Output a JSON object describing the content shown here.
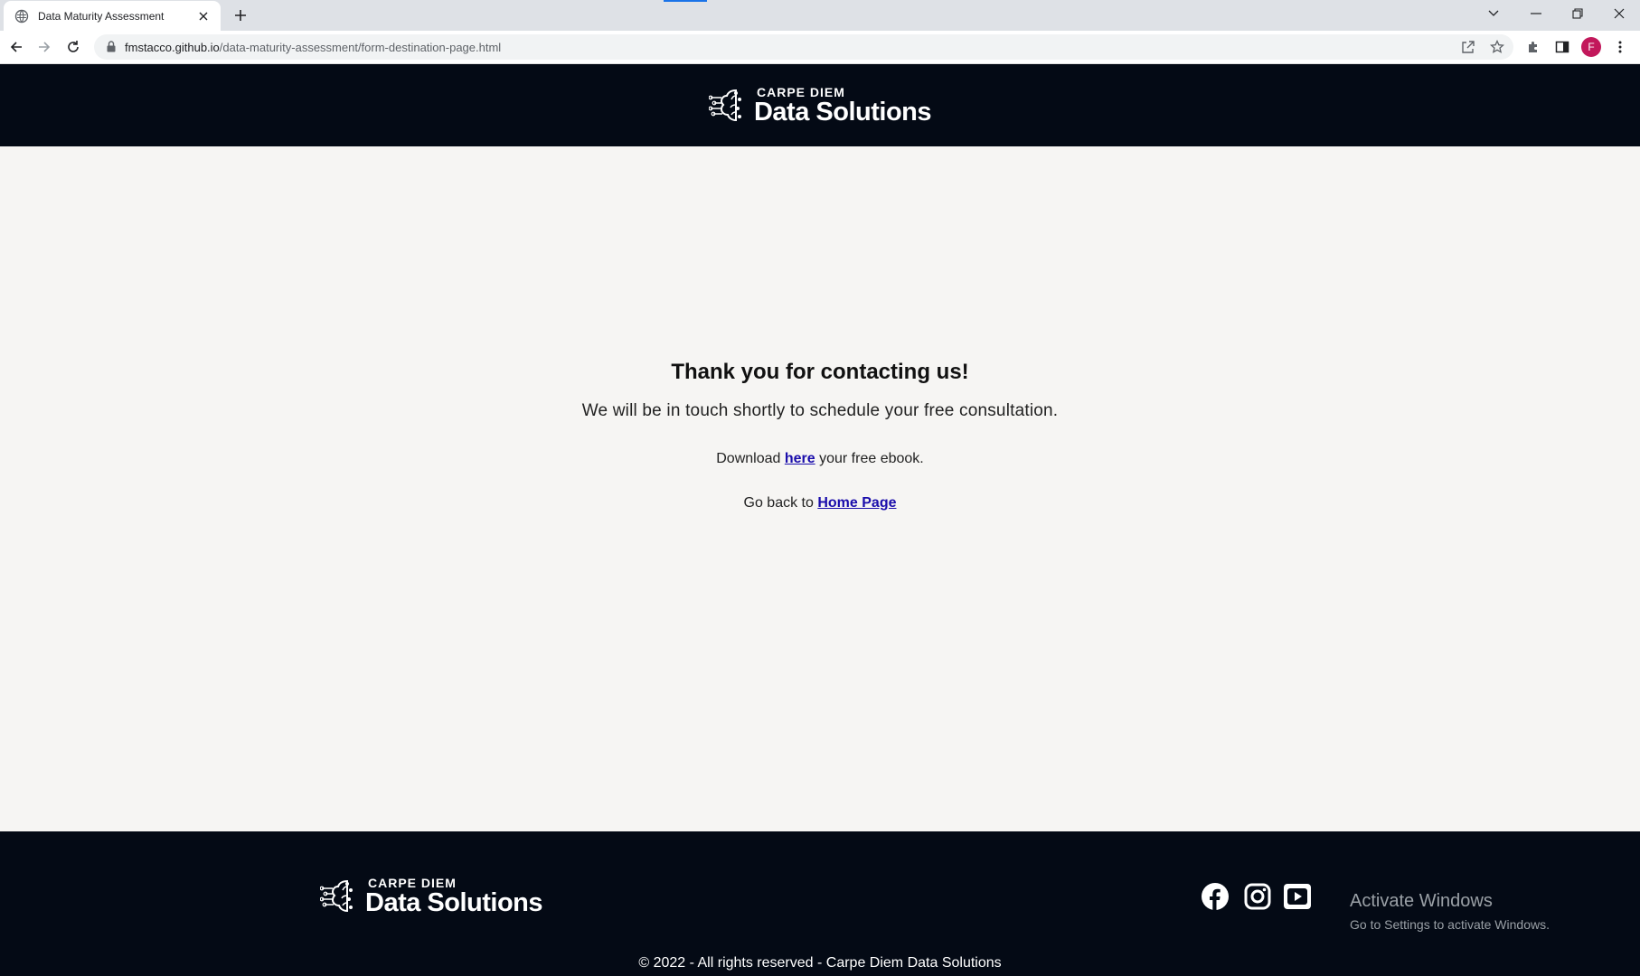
{
  "browser": {
    "tab_title": "Data Maturity Assessment",
    "url_host": "fmstacco.github.io",
    "url_path": "/data-maturity-assessment/form-destination-page.html",
    "profile_initial": "F",
    "profile_color": "#c2185b",
    "icons": [
      "globe-icon",
      "close-icon",
      "plus-icon",
      "chevron-down-icon",
      "minimize-icon",
      "restore-icon",
      "window-close-icon",
      "back-icon",
      "forward-icon",
      "reload-icon",
      "lock-icon",
      "share-icon",
      "star-icon",
      "extensions-icon",
      "side-panel-icon",
      "kebab-menu-icon"
    ]
  },
  "header": {
    "logo_top": "CARPE DIEM",
    "logo_bottom": "Data Solutions"
  },
  "main": {
    "heading": "Thank you for contacting us!",
    "subtext": "We will be in touch shortly to schedule your free consultation.",
    "download_prefix": "Download",
    "download_link": "here",
    "download_suffix": "your free ebook.",
    "back_prefix": "Go back to",
    "back_link": "Home Page"
  },
  "footer": {
    "logo_top": "CARPE DIEM",
    "logo_bottom": "Data Solutions",
    "social": [
      "facebook-icon",
      "instagram-icon",
      "youtube-icon"
    ],
    "copyright": "© 2022 - All rights reserved - Carpe Diem Data Solutions"
  },
  "os_watermark": {
    "title": "Activate Windows",
    "subtitle": "Go to Settings to activate Windows."
  },
  "colors": {
    "header_bg": "#040a15",
    "page_bg": "#f6f5f3",
    "link": "#1a0dab"
  }
}
